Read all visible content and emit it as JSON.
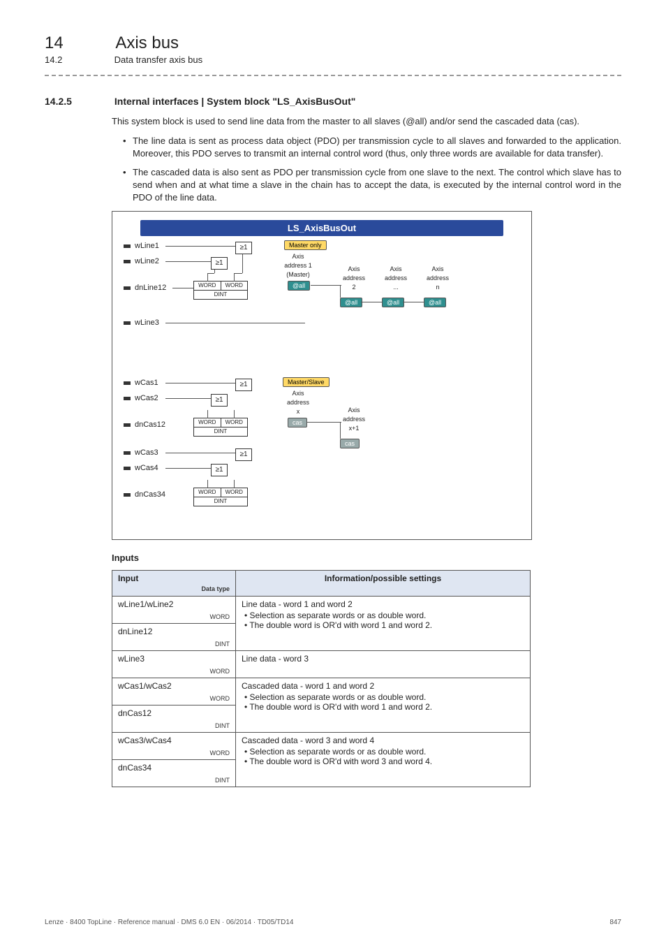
{
  "chapter": {
    "number": "14",
    "title": "Axis bus"
  },
  "subchapter": {
    "number": "14.2",
    "title": "Data transfer axis bus"
  },
  "section": {
    "number": "14.2.5",
    "title": "Internal interfaces | System block \"LS_AxisBusOut\"",
    "intro": "This system block is used to send line data from the master to all slaves (@all) and/or send the cascaded data (cas).",
    "bullets": [
      "The line data is sent as process data object (PDO) per transmission cycle to all slaves and forwarded to the application. Moreover, this PDO serves to transmit an internal control word (thus, only three words are available for data transfer).",
      "The cascaded data is also sent as PDO per transmission cycle from one slave to the next. The control which slave has to send when and at what time a slave in the chain has to accept the data, is executed by the internal control word in the PDO of the line data."
    ]
  },
  "diagram": {
    "title": "LS_AxisBusOut",
    "line_ports": [
      "wLine1",
      "wLine2",
      "dnLine12",
      "wLine3"
    ],
    "cas_ports": [
      "wCas1",
      "wCas2",
      "dnCas12",
      "wCas3",
      "wCas4",
      "dnCas34"
    ],
    "dint": {
      "word": "WORD",
      "dint": "DINT"
    },
    "or_label": "≥1",
    "tags": {
      "master_only": "Master only",
      "master_slave": "Master/Slave",
      "at_all": "@all",
      "cas": "cas"
    },
    "line_axis_cols": [
      {
        "l1": "Axis",
        "l2": "address 1",
        "l3": "(Master)"
      },
      {
        "l1": "Axis",
        "l2": "address",
        "l3": "2"
      },
      {
        "l1": "Axis",
        "l2": "address",
        "l3": "..."
      },
      {
        "l1": "Axis",
        "l2": "address",
        "l3": "n"
      }
    ],
    "cas_axis_cols": [
      {
        "l1": "Axis",
        "l2": "address",
        "l3": "x"
      },
      {
        "l1": "Axis",
        "l2": "address",
        "l3": "x+1"
      }
    ]
  },
  "inputs_heading": "Inputs",
  "table": {
    "head_input": "Input",
    "head_datatype": "Data type",
    "head_info": "Information/possible settings",
    "rows": [
      {
        "sig": "wLine1/wLine2",
        "dt": "WORD",
        "info_title": "Line data - word 1 and word 2",
        "info_b1": "Selection as separate words or as double word.",
        "info_b2": "The double word is OR'd with word 1 and word 2."
      },
      {
        "sig": "dnLine12",
        "dt": "DINT"
      },
      {
        "sig": "wLine3",
        "dt": "WORD",
        "info_title": "Line data - word 3"
      },
      {
        "sig": "wCas1/wCas2",
        "dt": "WORD",
        "info_title": "Cascaded data - word 1 and word 2",
        "info_b1": "Selection as separate words or as double word.",
        "info_b2": "The double word is OR'd with word 1 and word 2."
      },
      {
        "sig": "dnCas12",
        "dt": "DINT"
      },
      {
        "sig": "wCas3/wCas4",
        "dt": "WORD",
        "info_title": "Cascaded data - word 3 and word 4",
        "info_b1": "Selection as separate words or as double word.",
        "info_b2": "The double word is OR'd with word 3 and word 4."
      },
      {
        "sig": "dnCas34",
        "dt": "DINT"
      }
    ]
  },
  "footer": {
    "left": "Lenze · 8400 TopLine · Reference manual · DMS 6.0 EN · 06/2014 · TD05/TD14",
    "right": "847"
  }
}
